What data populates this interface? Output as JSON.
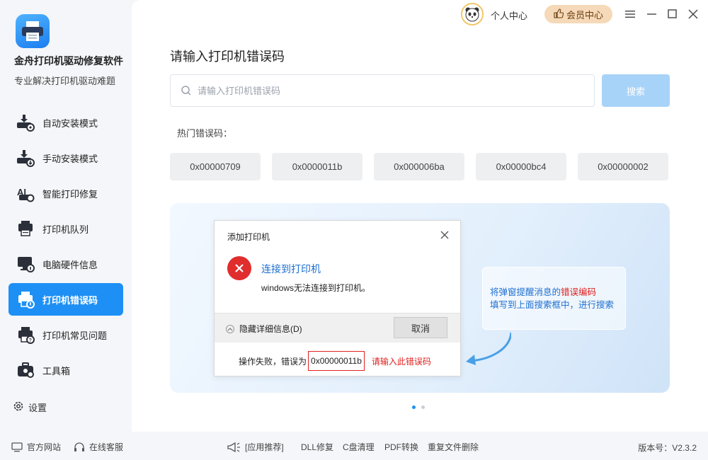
{
  "app": {
    "name": "金舟打印机驱动修复软件",
    "subtitle": "专业解决打印机驱动难题"
  },
  "sidebar": {
    "items": [
      {
        "label": "自动安装模式",
        "icon": "auto-install-icon"
      },
      {
        "label": "手动安装模式",
        "icon": "manual-install-icon"
      },
      {
        "label": "智能打印修复",
        "icon": "smart-repair-icon"
      },
      {
        "label": "打印机队列",
        "icon": "printer-queue-icon"
      },
      {
        "label": "电脑硬件信息",
        "icon": "hardware-info-icon"
      },
      {
        "label": "打印机错误码",
        "icon": "printer-error-icon",
        "active": true
      },
      {
        "label": "打印机常见问题",
        "icon": "printer-faq-icon"
      },
      {
        "label": "工具箱",
        "icon": "toolbox-icon"
      }
    ],
    "settings_label": "设置"
  },
  "topbar": {
    "personal_label": "个人中心",
    "vip_label": "会员中心"
  },
  "main": {
    "title": "请输入打印机错误码",
    "search_placeholder": "请输入打印机错误码",
    "search_button": "搜索",
    "hot_label": "热门错误码：",
    "hot_codes": [
      "0x00000709",
      "0x0000011b",
      "0x000006ba",
      "0x00000bc4",
      "0x00000002"
    ]
  },
  "illustration": {
    "dialog_title": "添加打印机",
    "error_heading": "连接到打印机",
    "error_message": "windows无法连接到打印机。",
    "details_toggle": "隐藏详细信息(D)",
    "cancel_label": "取消",
    "fail_prefix": "操作失败，错误为",
    "fail_code": "0x00000011b",
    "fail_hint": "请输入此错误码",
    "tip_line1_a": "将弹窗提醒消息的",
    "tip_line1_b": "错误编码",
    "tip_line2": "填写到上面搜索框中，进行搜索"
  },
  "bottom": {
    "official_site": "官方网站",
    "online_service": "在线客服",
    "recommend": "[应用推荐]",
    "apps": [
      "DLL修复",
      "C盘清理",
      "PDF转换",
      "重复文件删除"
    ],
    "version": "版本号：V2.3.2"
  },
  "colors": {
    "accent": "#1e90f5",
    "search_button": "#a8d3f8",
    "error_red": "#e02d2d",
    "vip_bg": "#f5d9b8"
  }
}
